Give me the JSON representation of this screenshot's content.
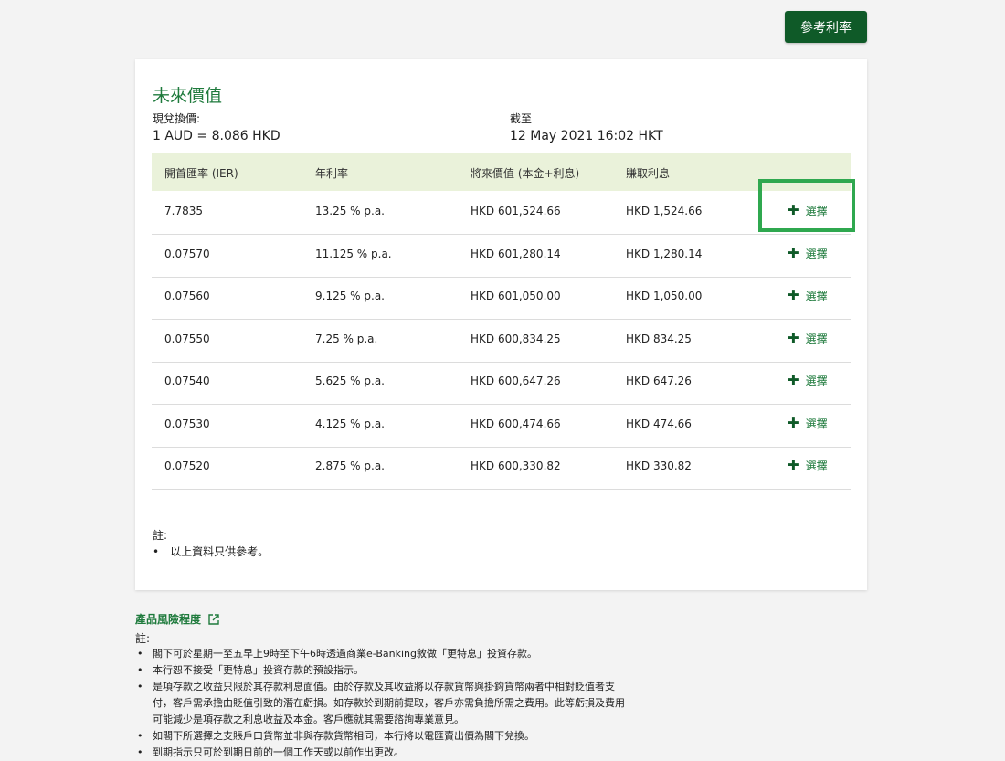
{
  "header": {
    "reference_rate_button": "參考利率"
  },
  "card": {
    "title": "未來價值",
    "exchange_label": "現兌換價:",
    "exchange_value": "1 AUD = 8.086 HKD",
    "asof_label": "截至",
    "asof_value": "12 May 2021 16:02 HKT",
    "columns": [
      "開首匯率 (IER)",
      "年利率",
      "將來價值 (本金+利息)",
      "賺取利息"
    ],
    "select_label": "選擇",
    "rows": [
      {
        "ier": "7.7835",
        "rate": "13.25 % p.a.",
        "future": "HKD 601,524.66",
        "interest": "HKD 1,524.66"
      },
      {
        "ier": "0.07570",
        "rate": "11.125 % p.a.",
        "future": "HKD 601,280.14",
        "interest": "HKD 1,280.14"
      },
      {
        "ier": "0.07560",
        "rate": "9.125 % p.a.",
        "future": "HKD 601,050.00",
        "interest": "HKD 1,050.00"
      },
      {
        "ier": "0.07550",
        "rate": "7.25 % p.a.",
        "future": "HKD 600,834.25",
        "interest": "HKD 834.25"
      },
      {
        "ier": "0.07540",
        "rate": "5.625 % p.a.",
        "future": "HKD 600,647.26",
        "interest": "HKD 647.26"
      },
      {
        "ier": "0.07530",
        "rate": "4.125 % p.a.",
        "future": "HKD 600,474.66",
        "interest": "HKD 474.66"
      },
      {
        "ier": "0.07520",
        "rate": "2.875 % p.a.",
        "future": "HKD 600,330.82",
        "interest": "HKD 330.82"
      }
    ],
    "note_title": "註:",
    "note_item": "以上資料只供參考。"
  },
  "footer": {
    "risk_link": "產品風險程度",
    "note_title": "註:",
    "items": [
      "閣下可於星期一至五早上9時至下午6時透過商業e-Banking敘做「更特息」投資存款。",
      "本行恕不接受「更特息」投資存款的預設指示。",
      "是項存款之收益只限於其存款利息面值。由於存款及其收益將以存款貨幣與掛鈎貨幣兩者中相對貶值者支付，客戶需承擔由貶值引致的潛在虧損。如存款於到期前提取，客戶亦需負擔所需之費用。此等虧損及費用可能減少是項存款之利息收益及本金。客戶應就其需要諮詢專業意見。",
      "如閣下所選擇之支賬戶口貨幣並非與存款貨幣相同，本行將以電匯賣出價為閣下兌換。",
      "到期指示只可於到期日前的一個工作天或以前作出更改。"
    ]
  },
  "colors": {
    "brand_green": "#0f5a28",
    "accent_green": "#1e7a3c",
    "header_bg": "#eaf2da",
    "highlight": "#2fa84f"
  }
}
